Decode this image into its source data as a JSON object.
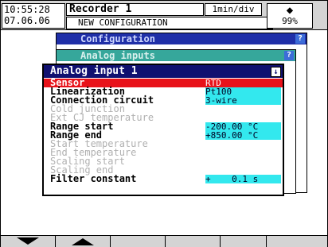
{
  "header": {
    "time": "10:55:28",
    "date": "07.06.06",
    "recorder_title": "Recorder 1",
    "speed": "1min/div",
    "subtitle": "NEW CONFIGURATION",
    "memory_icon": "memory-card-icon",
    "memory_pct": "99%"
  },
  "windows": {
    "configuration": {
      "title": "Configuration",
      "help": "?"
    },
    "analog_inputs": {
      "title": "Analog inputs",
      "help": "?"
    },
    "analog_input_1": {
      "title": "Analog input 1",
      "down": "↓"
    }
  },
  "params": [
    {
      "label": "Sensor",
      "value": "RTD",
      "state": "selected"
    },
    {
      "label": "Linearization",
      "value": "Pt100",
      "state": "normal"
    },
    {
      "label": "Connection circuit",
      "value": "3-wire",
      "state": "normal"
    },
    {
      "label": "Cold junction",
      "value": "",
      "state": "disabled"
    },
    {
      "label": "Ext CJ temperature",
      "value": "",
      "state": "disabled"
    },
    {
      "label": "Range start",
      "value": "-200.00 °C",
      "state": "normal"
    },
    {
      "label": "Range end",
      "value": "+850.00 °C",
      "state": "normal"
    },
    {
      "label": "Start temperature",
      "value": "",
      "state": "disabled"
    },
    {
      "label": "End temperature",
      "value": "",
      "state": "disabled"
    },
    {
      "label": "Scaling start",
      "value": "",
      "state": "disabled"
    },
    {
      "label": "Scaling end",
      "value": "",
      "state": "disabled"
    },
    {
      "label": "Filter constant",
      "value": "+    0.1 s",
      "state": "normal"
    }
  ],
  "softkeys": [
    {
      "name": "arrow-down",
      "icon": "arrow-down-icon"
    },
    {
      "name": "arrow-up",
      "icon": "arrow-up-icon"
    },
    {
      "name": "empty-3",
      "icon": ""
    },
    {
      "name": "empty-4",
      "icon": ""
    },
    {
      "name": "empty-5",
      "icon": ""
    },
    {
      "name": "empty-6",
      "icon": ""
    }
  ],
  "colors": {
    "selected": "#e8121a",
    "value_bg": "#33e8ee",
    "title_dark": "#101070",
    "title_conf": "#1f2fa8",
    "title_analog": "#36a79b"
  }
}
